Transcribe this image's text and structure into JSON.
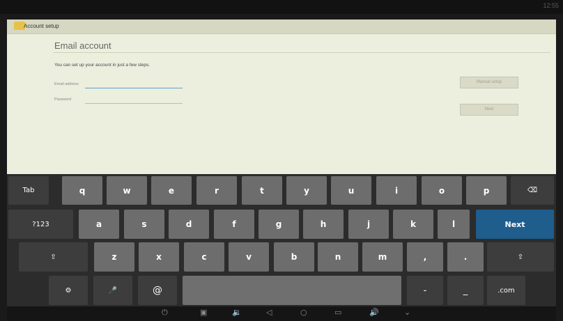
{
  "status_bar": {
    "clock": "12:55"
  },
  "app": {
    "title": "Account setup",
    "heading": "Email account",
    "intro": "You can set up your account in just a few steps.",
    "email_label": "Email address",
    "email_value": "",
    "password_label": "Password",
    "password_value": "",
    "manual_setup_label": "Manual setup",
    "next_label": "Next"
  },
  "keyboard": {
    "row1": {
      "tab": "Tab",
      "keys": [
        "q",
        "w",
        "e",
        "r",
        "t",
        "y",
        "u",
        "i",
        "o",
        "p"
      ]
    },
    "row2": {
      "sym": "?123",
      "keys": [
        "a",
        "s",
        "d",
        "f",
        "g",
        "h",
        "j",
        "k",
        "l"
      ],
      "action": "Next"
    },
    "row3": {
      "keys": [
        "z",
        "x",
        "c",
        "v",
        "b",
        "n",
        "m",
        ",",
        "."
      ]
    },
    "row4": {
      "at": "@",
      "dash": "-",
      "underscore": "_",
      "dotcom": ".com"
    }
  },
  "icons": {
    "backspace": "⌫",
    "shift": "⇧",
    "settings": "⚙",
    "mic": "🎤",
    "power": "⏻",
    "screenshot": "▣",
    "volume_down": "🔉",
    "back": "◁",
    "home": "○",
    "recent": "▭",
    "volume_up": "🔊",
    "hide_keyboard": "⌄"
  }
}
